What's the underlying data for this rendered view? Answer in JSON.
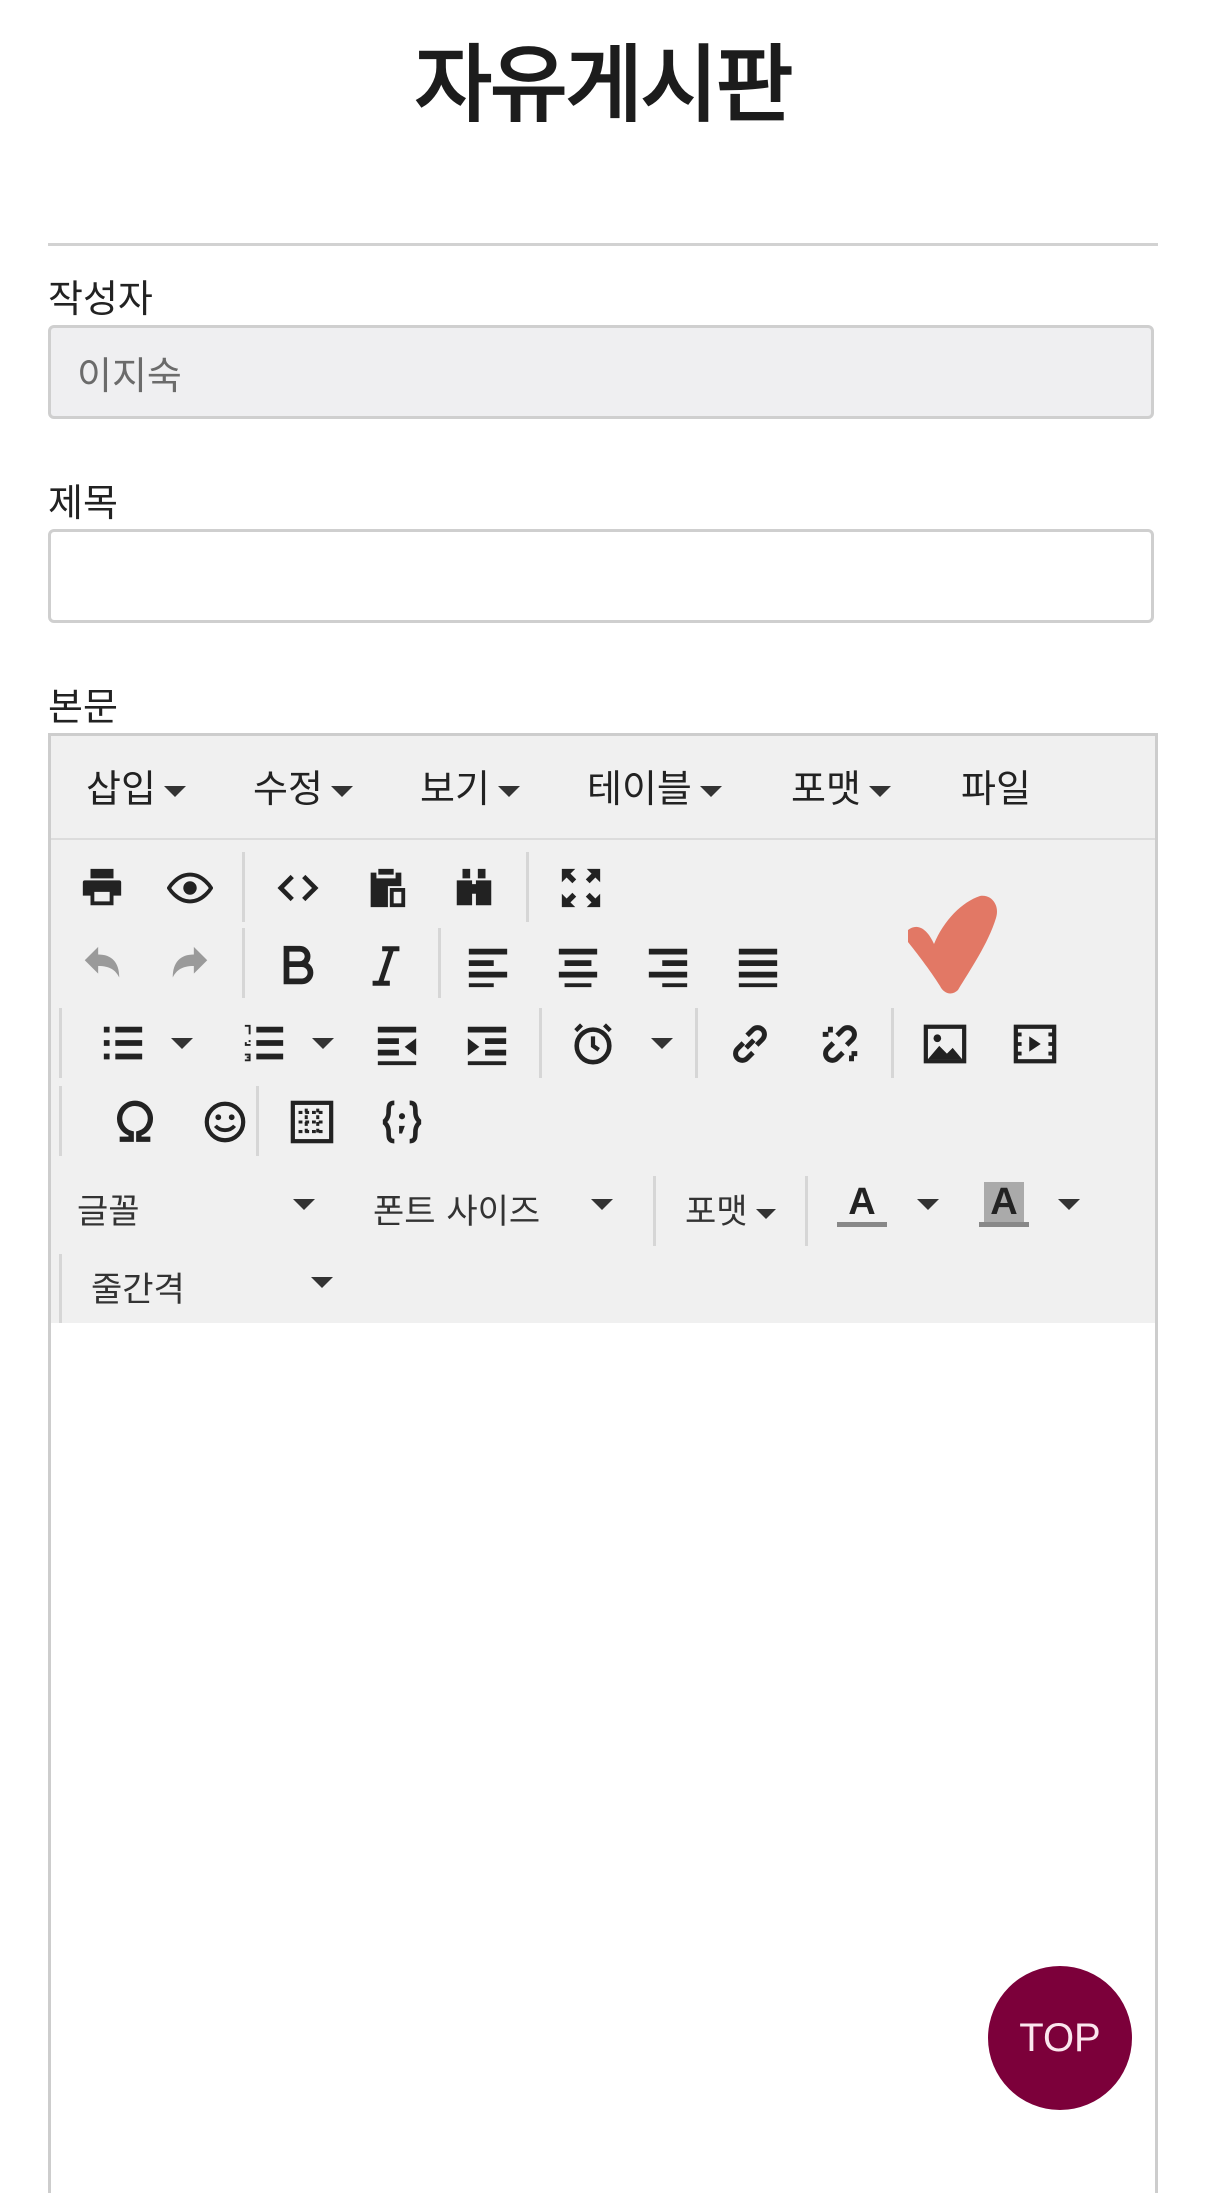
{
  "page": {
    "title": "자유게시판"
  },
  "form": {
    "author_label": "작성자",
    "author_value": "이지숙",
    "title_label": "제목",
    "title_value": "",
    "body_label": "본문"
  },
  "editor": {
    "menu": [
      "삽입",
      "수정",
      "보기",
      "테이블",
      "포맷",
      "파일"
    ],
    "font_family_label": "글꼴",
    "font_size_label": "폰트 사이즈",
    "format_label": "포맷",
    "line_height_label": "줄간격",
    "text_color_glyph": "A",
    "bg_color_glyph": "A"
  },
  "top_button": {
    "label": "TOP"
  },
  "colors": {
    "top_button": "#7c003a",
    "toolbar_bg": "#f0f0f0",
    "annotation": "#e06a55"
  }
}
